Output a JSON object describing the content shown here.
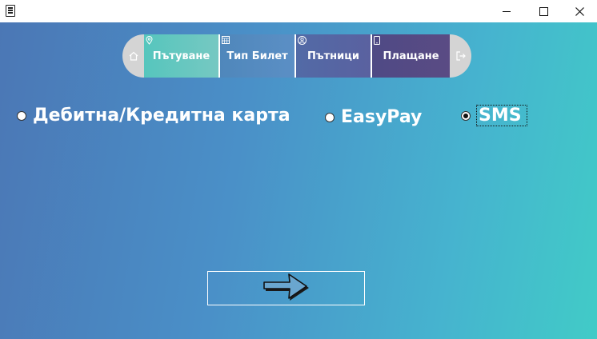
{
  "window": {
    "icon": "document-icon",
    "controls": [
      "minimize",
      "maximize",
      "close"
    ]
  },
  "nav": {
    "steps": [
      {
        "label": "Пътуване",
        "icon": "location-pin-icon"
      },
      {
        "label": "Тип Билет",
        "icon": "calendar-icon"
      },
      {
        "label": "Пътници",
        "icon": "user-icon"
      },
      {
        "label": "Плащане",
        "icon": "phone-icon"
      }
    ],
    "home_icon": "home-icon",
    "exit_icon": "exit-icon",
    "active_step": "Плащане"
  },
  "payment": {
    "options": [
      {
        "label": "Дебитна/Кредитна карта",
        "checked": false
      },
      {
        "label": "EasyPay",
        "checked": false
      },
      {
        "label": "SMS",
        "checked": true
      }
    ]
  },
  "next_button": {
    "icon": "arrow-right-icon"
  },
  "colors": {
    "gradient_left": "#4b77b5",
    "gradient_right": "#41cbc7",
    "nav_pill": "#d4d4d4",
    "active_step": "#4f4a85"
  }
}
